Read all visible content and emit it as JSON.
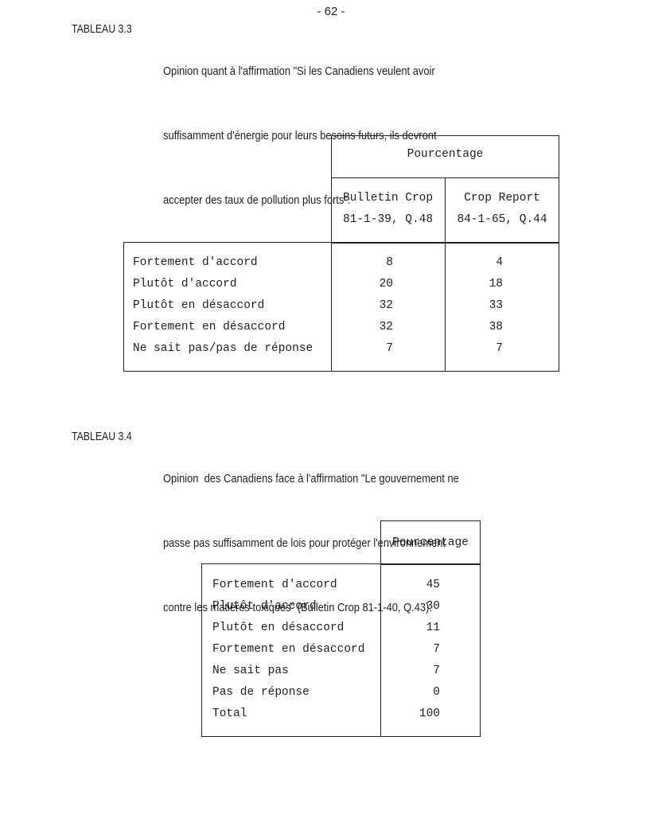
{
  "page_number": "- 62 -",
  "table_3_3": {
    "label": "TABLEAU 3.3",
    "caption_lines": [
      "Opinion quant à l'affirmation \"Si les Canadiens veulent avoir",
      "suffisamment d'énergie pour leurs besoins futurs, ils devront",
      "accepter des taux de pollution plus forts\"."
    ],
    "group_header": "Pourcentage",
    "columns": [
      {
        "line1": "Bulletin Crop",
        "line2": "81-1-39, Q.48"
      },
      {
        "line1": "Crop Report",
        "line2": "84-1-65, Q.44"
      }
    ],
    "rows": [
      {
        "label": "Fortement d'accord",
        "values": [
          "8",
          "4"
        ]
      },
      {
        "label": "Plutôt d'accord",
        "values": [
          "20",
          "18"
        ]
      },
      {
        "label": "Plutôt en désaccord",
        "values": [
          "32",
          "33"
        ]
      },
      {
        "label": "Fortement en désaccord",
        "values": [
          "32",
          "38"
        ]
      },
      {
        "label": "Ne sait pas/pas de réponse",
        "values": [
          "7",
          "7"
        ]
      }
    ]
  },
  "table_3_4": {
    "label": "TABLEAU 3.4",
    "caption_lines": [
      "Opinion  des Canadiens face à l'affirmation \"Le gouvernement ne",
      "passe pas suffisamment de lois pour protéger l'environnement",
      "contre les matières toxiques\" (Bulletin Crop 81-1-40, Q.43)."
    ],
    "column_header": "Pourcentage",
    "rows": [
      {
        "label": "Fortement d'accord",
        "value": "45"
      },
      {
        "label": "Plutôt d'accord",
        "value": "30"
      },
      {
        "label": "Plutôt en désaccord",
        "value": "11"
      },
      {
        "label": "Fortement en désaccord",
        "value": "7"
      },
      {
        "label": "Ne sait pas",
        "value": "7"
      },
      {
        "label": "Pas de réponse",
        "value": "0"
      },
      {
        "label": "Total",
        "value": "100"
      }
    ]
  }
}
